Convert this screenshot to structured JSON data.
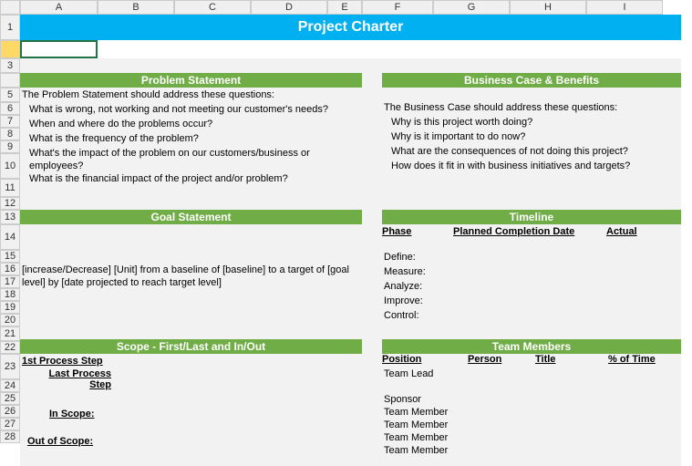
{
  "columns": [
    "A",
    "B",
    "C",
    "D",
    "E",
    "F",
    "G",
    "H",
    "I"
  ],
  "rows": [
    "1",
    "",
    "3",
    "",
    "5",
    "6",
    "7",
    "8",
    "9",
    "10",
    "11",
    "12",
    "13",
    "14",
    "15",
    "16",
    "17",
    "18",
    "19",
    "20",
    "21",
    "22",
    "23",
    "24",
    "25",
    "26",
    "27",
    "28"
  ],
  "title": "Project Charter",
  "problem": {
    "header": "Problem Statement",
    "intro": "The Problem Statement should address these questions:",
    "q1": "What is wrong, not working and not meeting our customer's needs?",
    "q2": "When and where do the problems occur?",
    "q3": "What is the frequency of the problem?",
    "q4": "What's the impact of the problem on our customers/business or employees?",
    "q5": "What is the financial impact of the project and/or problem?"
  },
  "business": {
    "header": "Business Case & Benefits",
    "intro": "The Business Case should address these questions:",
    "q1": "Why is this project worth doing?",
    "q2": "Why is it important to do now?",
    "q3": "What are the consequences of not doing this project?",
    "q4": "How does it fit in with business initiatives and targets?"
  },
  "goal": {
    "header": "Goal Statement",
    "text": "[increase/Decrease] [Unit] from a baseline of [baseline] to a target of [goal level] by [date projected to reach target level]"
  },
  "timeline": {
    "header": "Timeline",
    "col_phase": "Phase",
    "col_planned": "Planned Completion Date",
    "col_actual": "Actual",
    "phases": [
      "Define:",
      "Measure:",
      "Analyze:",
      "Improve:",
      "Control:"
    ]
  },
  "scope": {
    "header": "Scope - First/Last and In/Out",
    "first": "1st Process Step",
    "last": "Last Process Step",
    "in": "In Scope:",
    "out": "Out of Scope:"
  },
  "team": {
    "header": "Team Members",
    "col_position": "Position",
    "col_person": "Person",
    "col_title": "Title",
    "col_pct": "% of Time",
    "rows": [
      "Team Lead",
      "",
      "Sponsor",
      "Team Member",
      "Team Member",
      "Team Member",
      "Team Member"
    ]
  }
}
